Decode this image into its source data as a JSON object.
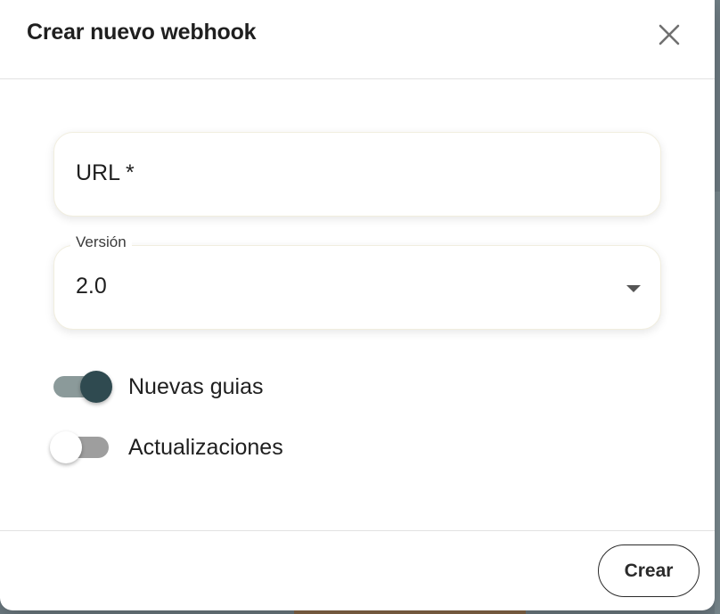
{
  "dialog": {
    "title": "Crear nuevo webhook",
    "close_icon": "close-icon"
  },
  "form": {
    "url_field": {
      "label": "URL *",
      "value": ""
    },
    "version_field": {
      "label": "Versión",
      "selected": "2.0",
      "icon": "dropdown-arrow-icon"
    },
    "toggles": [
      {
        "label": "Nuevas guias",
        "checked": true
      },
      {
        "label": "Actualizaciones",
        "checked": false
      }
    ]
  },
  "footer": {
    "create_label": "Crear"
  },
  "colors": {
    "toggle_on_knob": "#2f4a50",
    "toggle_on_track": "#8b9a9a",
    "toggle_off_track": "#9e9e9e"
  }
}
